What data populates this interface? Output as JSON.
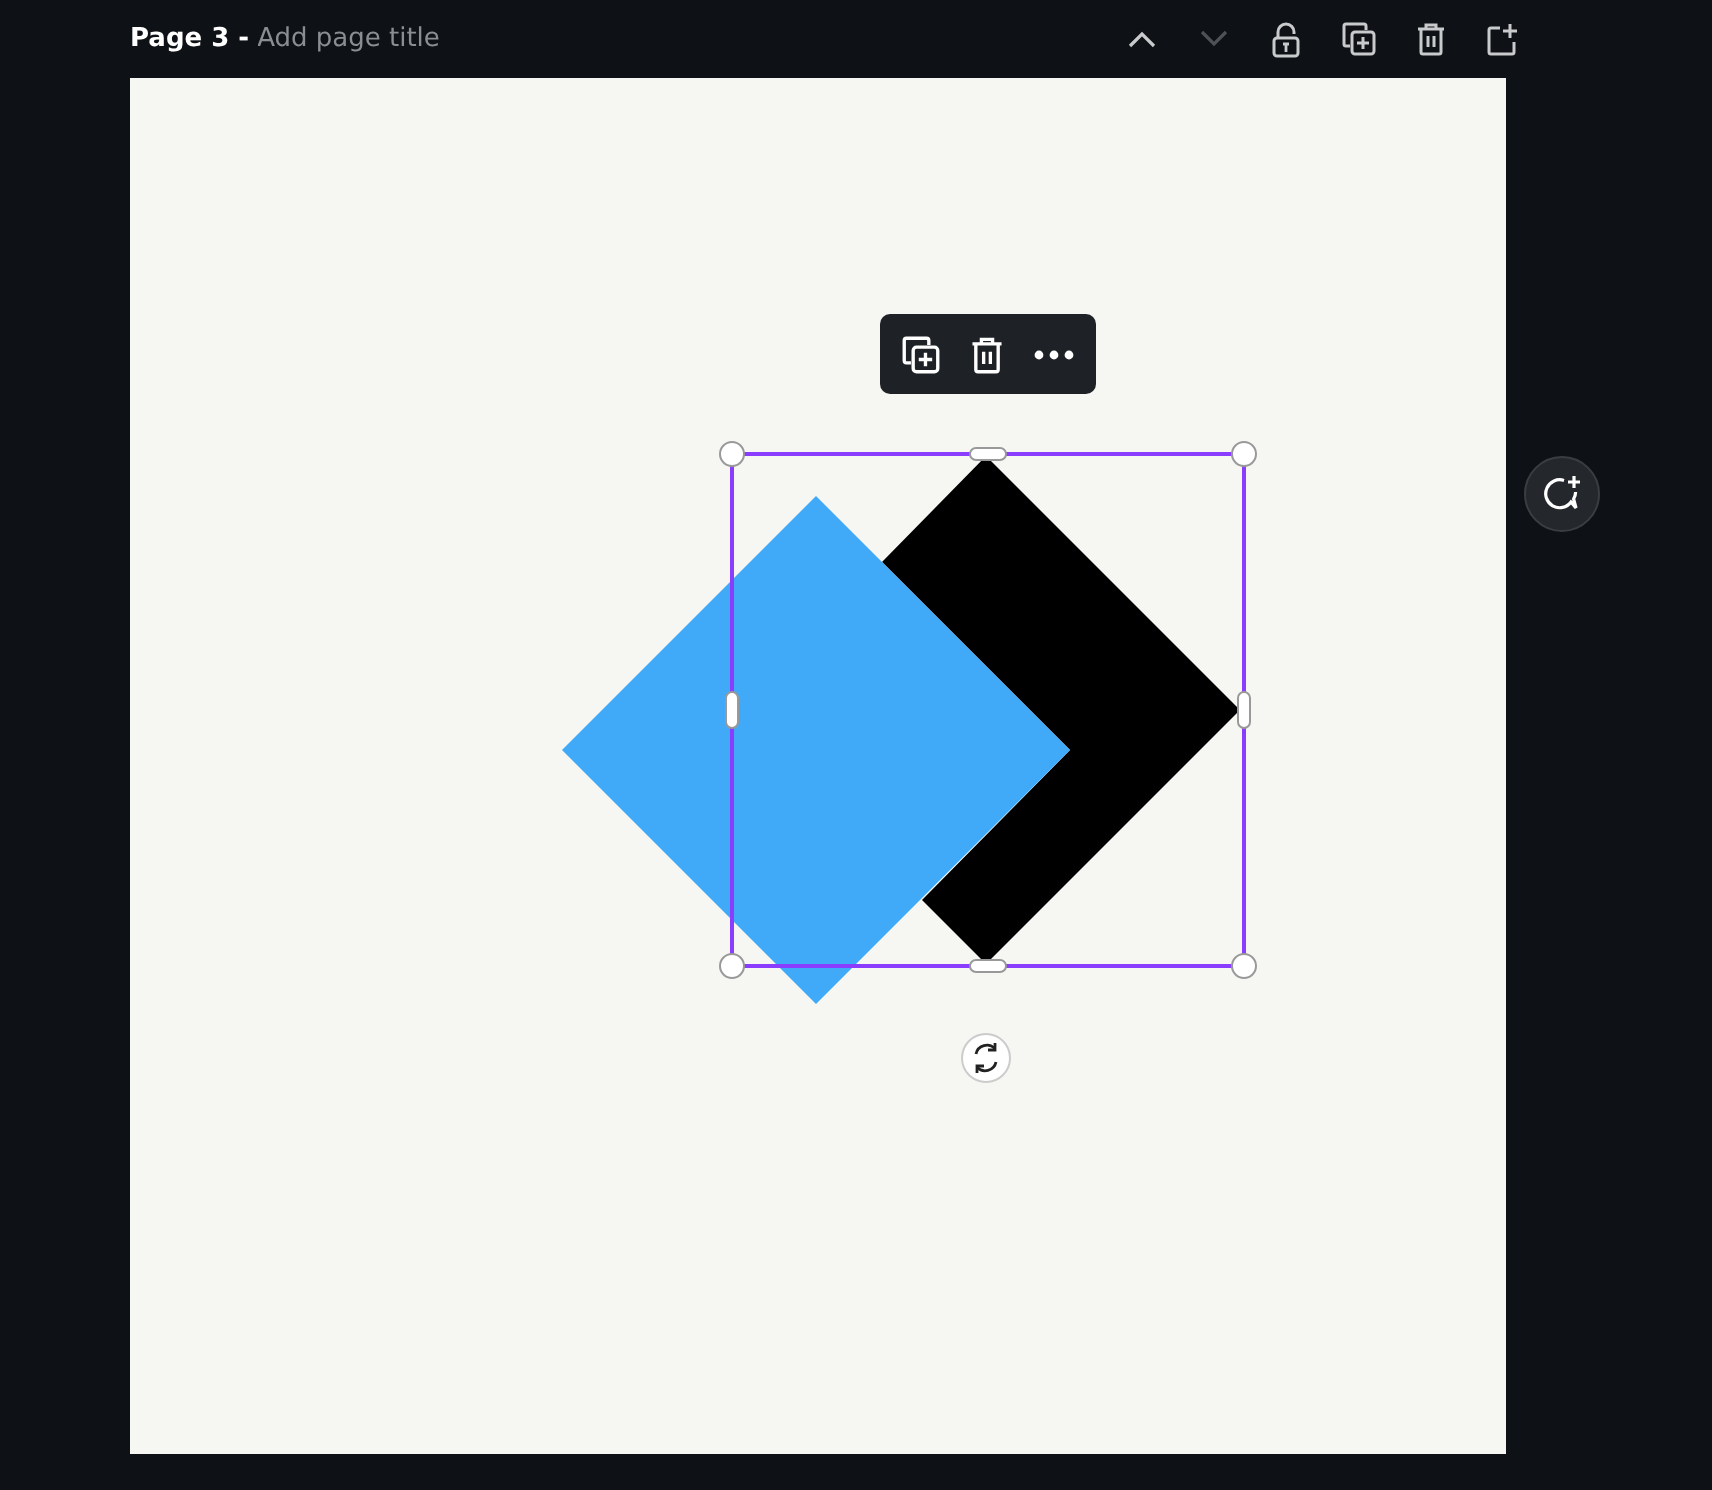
{
  "page_header": {
    "page_label": "Page 3 -",
    "title_placeholder": "Add page title",
    "actions": [
      {
        "kind": "up",
        "disabled": false
      },
      {
        "kind": "down",
        "disabled": true
      },
      {
        "kind": "lock",
        "disabled": false
      },
      {
        "kind": "duplicate",
        "disabled": false
      },
      {
        "kind": "delete",
        "disabled": false
      },
      {
        "kind": "add",
        "disabled": false
      }
    ]
  },
  "canvas": {
    "shapes": [
      {
        "kind": "diamond",
        "color": "#000000",
        "selected": true
      },
      {
        "kind": "diamond",
        "color": "#40aaf8",
        "selected": false
      }
    ],
    "element_toolbar": [
      {
        "kind": "duplicate"
      },
      {
        "kind": "delete"
      },
      {
        "kind": "more"
      }
    ]
  }
}
